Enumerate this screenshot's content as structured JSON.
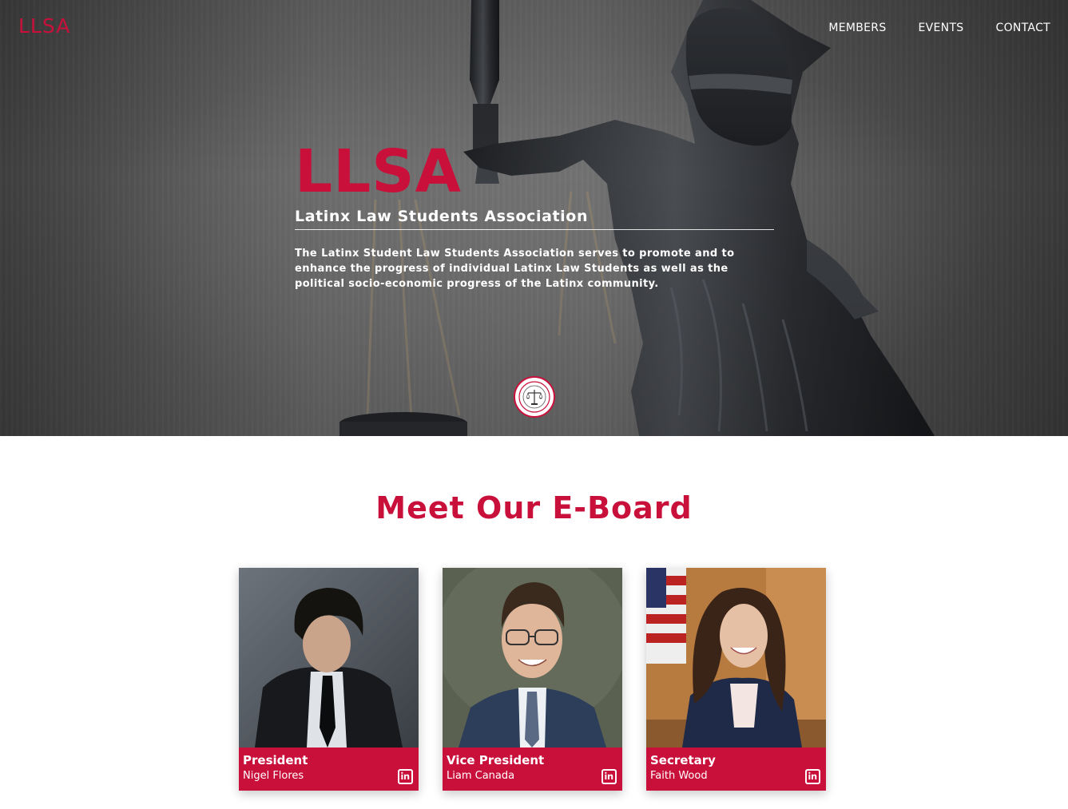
{
  "header": {
    "brand": "LLSA",
    "nav": [
      {
        "label": "MEMBERS"
      },
      {
        "label": "EVENTS"
      },
      {
        "label": "CONTACT"
      }
    ]
  },
  "hero": {
    "title": "LLSA",
    "subtitle": "Latinx Law Students Association",
    "description": "The Latinx Student Law Students Association serves to promote and to enhance the progress of individual Latinx Law Students as well as the political socio-economic progress of the Latinx community.",
    "background_image": "statue-of-lady-justice",
    "seal_icon": "scales-seal-icon"
  },
  "eboard": {
    "title": "Meet Our E-Board",
    "members": [
      {
        "role": "President",
        "name": "Nigel Flores",
        "photo": "president-photo",
        "icon": "linkedin-icon"
      },
      {
        "role": "Vice President",
        "name": "Liam Canada",
        "photo": "vice-president-photo",
        "icon": "linkedin-icon"
      },
      {
        "role": "Secretary",
        "name": "Faith Wood",
        "photo": "secretary-photo",
        "icon": "linkedin-icon"
      }
    ]
  },
  "colors": {
    "accent": "#c8103b",
    "hero_text": "#ffffff",
    "page_background": "#ffffff"
  }
}
